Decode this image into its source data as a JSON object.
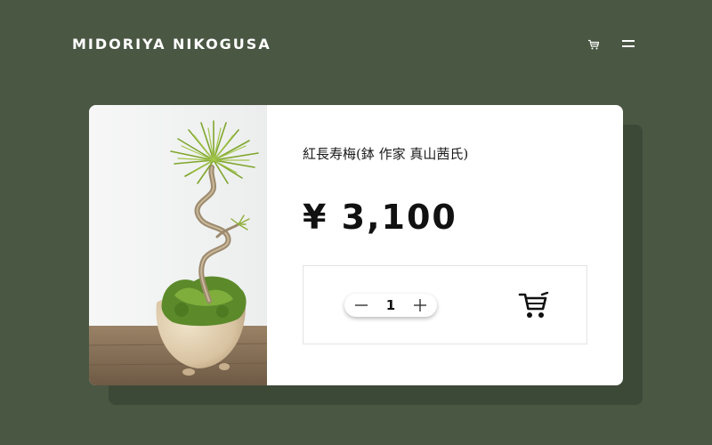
{
  "header": {
    "brand": "MIDORIYA NIKOGUSA",
    "cart_icon": "cart-icon",
    "menu_icon": "menu-icon"
  },
  "product": {
    "title": "紅長寿梅(鉢 作家 真山茜氏)",
    "price": "¥ 3,100",
    "image": "bonsai-pine-photo",
    "quantity": "1",
    "minus_icon": "minus-icon",
    "plus_icon": "plus-icon",
    "add_to_cart_icon": "cart-icon"
  },
  "colors": {
    "background": "#4a5743",
    "card_shadow": "#3d4937",
    "card": "#ffffff",
    "text": "#111111"
  }
}
